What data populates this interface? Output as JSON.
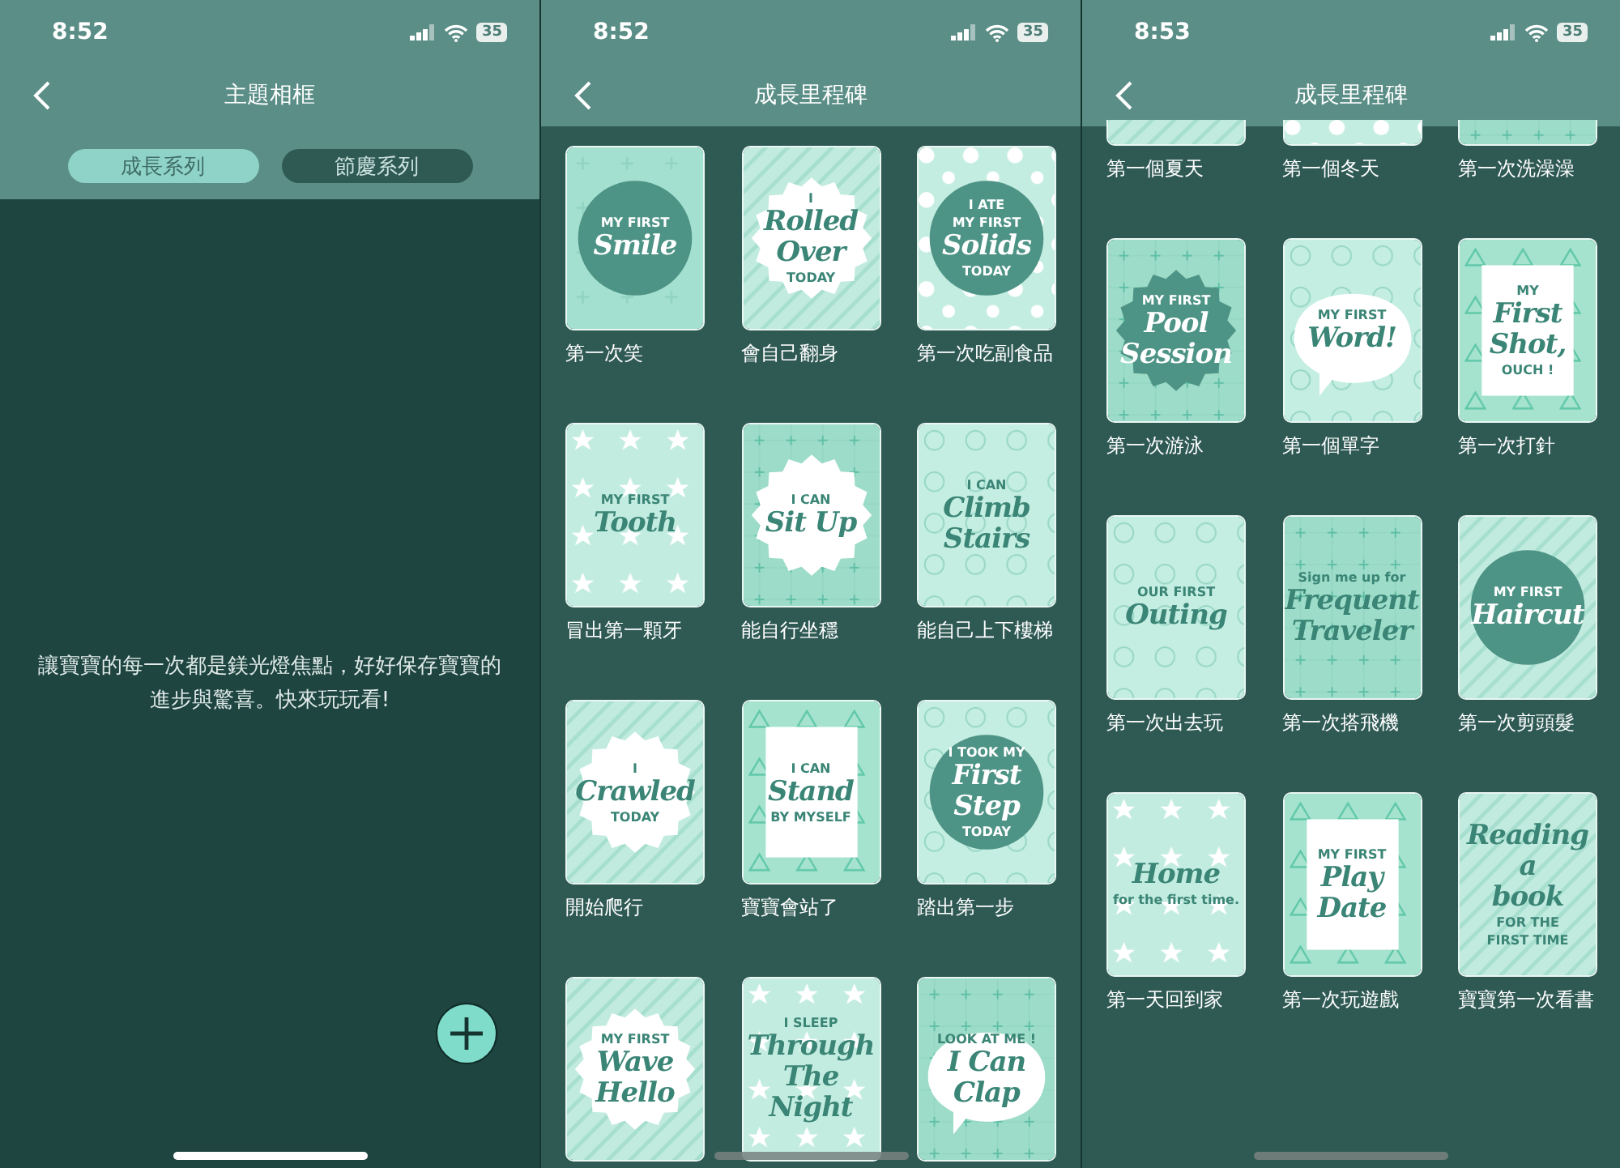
{
  "screens": [
    {
      "status": {
        "time": "8:52",
        "battery": "35"
      },
      "title": "主題相框",
      "tabs": [
        {
          "label": "成長系列",
          "selected": true
        },
        {
          "label": "節慶系列",
          "selected": false
        }
      ],
      "message": "讓寶寶的每一次都是鎂光燈焦點，好好保存寶寶的進步與驚喜。快來玩玩看!"
    },
    {
      "status": {
        "time": "8:52",
        "battery": "35"
      },
      "title": "成長里程碑",
      "milestones": [
        {
          "label": "第一次笑",
          "kind": "circle",
          "lines": [
            {
              "text": "MY FIRST",
              "kind": "small"
            },
            {
              "text": "Smile",
              "kind": "script"
            }
          ]
        },
        {
          "label": "會自己翻身",
          "kind": "burst",
          "lines": [
            {
              "text": "I",
              "kind": "small"
            },
            {
              "text": "Rolled",
              "kind": "script"
            },
            {
              "text": "Over",
              "kind": "script"
            },
            {
              "text": "TODAY",
              "kind": "small"
            }
          ]
        },
        {
          "label": "第一次吃副食品",
          "kind": "circle",
          "lines": [
            {
              "text": "I ATE",
              "kind": "small"
            },
            {
              "text": "MY FIRST",
              "kind": "small"
            },
            {
              "text": "Solids",
              "kind": "script"
            },
            {
              "text": "TODAY",
              "kind": "small"
            }
          ]
        },
        {
          "label": "冒出第一顆牙",
          "kind": "plain",
          "lines": [
            {
              "text": "MY FIRST",
              "kind": "small"
            },
            {
              "text": "Tooth",
              "kind": "script"
            }
          ]
        },
        {
          "label": "能自行坐穩",
          "kind": "burst",
          "lines": [
            {
              "text": "I CAN",
              "kind": "small"
            },
            {
              "text": "Sit Up",
              "kind": "script"
            }
          ]
        },
        {
          "label": "能自己上下樓梯",
          "kind": "plain",
          "lines": [
            {
              "text": "I CAN",
              "kind": "small"
            },
            {
              "text": "Climb",
              "kind": "script"
            },
            {
              "text": "Stairs",
              "kind": "script"
            }
          ]
        },
        {
          "label": "開始爬行",
          "kind": "burst",
          "lines": [
            {
              "text": "I",
              "kind": "small"
            },
            {
              "text": "Crawled",
              "kind": "script"
            },
            {
              "text": "TODAY",
              "kind": "small"
            }
          ]
        },
        {
          "label": "寶寶會站了",
          "kind": "rect",
          "lines": [
            {
              "text": "I CAN",
              "kind": "small"
            },
            {
              "text": "Stand",
              "kind": "script"
            },
            {
              "text": "BY MYSELF",
              "kind": "small"
            }
          ]
        },
        {
          "label": "踏出第一步",
          "kind": "circle",
          "lines": [
            {
              "text": "I TOOK MY",
              "kind": "small"
            },
            {
              "text": "First",
              "kind": "script"
            },
            {
              "text": "Step",
              "kind": "script"
            },
            {
              "text": "TODAY",
              "kind": "small"
            }
          ]
        },
        {
          "kind": "burst",
          "lines": [
            {
              "text": "MY FIRST",
              "kind": "small"
            },
            {
              "text": "Wave",
              "kind": "script"
            },
            {
              "text": "Hello",
              "kind": "script"
            }
          ]
        },
        {
          "kind": "plain",
          "lines": [
            {
              "text": "I SLEEP",
              "kind": "small"
            },
            {
              "text": "Through",
              "kind": "script"
            },
            {
              "text": "The",
              "kind": "script"
            },
            {
              "text": "Night",
              "kind": "script"
            }
          ]
        },
        {
          "kind": "bubble",
          "lines": [
            {
              "text": "LOOK AT ME !",
              "kind": "small"
            },
            {
              "text": "I Can",
              "kind": "script"
            },
            {
              "text": "Clap",
              "kind": "script"
            }
          ]
        }
      ]
    },
    {
      "status": {
        "time": "8:53",
        "battery": "35"
      },
      "title": "成長里程碑",
      "milestones": [
        {
          "label": "第一個夏天",
          "kind": "stub"
        },
        {
          "label": "第一個冬天",
          "kind": "stub"
        },
        {
          "label": "第一次洗澡澡",
          "kind": "stub"
        },
        {
          "label": "第一次游泳",
          "kind": "darkburst",
          "lines": [
            {
              "text": "MY FIRST",
              "kind": "small"
            },
            {
              "text": "Pool",
              "kind": "script"
            },
            {
              "text": "Session",
              "kind": "script"
            }
          ]
        },
        {
          "label": "第一個單字",
          "kind": "bubble",
          "lines": [
            {
              "text": "MY FIRST",
              "kind": "small"
            },
            {
              "text": "Word!",
              "kind": "script"
            }
          ]
        },
        {
          "label": "第一次打針",
          "kind": "rect",
          "lines": [
            {
              "text": "MY",
              "kind": "small"
            },
            {
              "text": "First",
              "kind": "script"
            },
            {
              "text": "Shot,",
              "kind": "script"
            },
            {
              "text": "OUCH !",
              "kind": "small"
            }
          ]
        },
        {
          "label": "第一次出去玩",
          "kind": "plain",
          "lines": [
            {
              "text": "OUR FIRST",
              "kind": "small"
            },
            {
              "text": "Outing",
              "kind": "script"
            }
          ]
        },
        {
          "label": "第一次搭飛機",
          "kind": "plain",
          "lines": [
            {
              "text": "Sign me up for",
              "kind": "small"
            },
            {
              "text": "Frequent",
              "kind": "script"
            },
            {
              "text": "Traveler",
              "kind": "script"
            }
          ]
        },
        {
          "label": "第一次剪頭髮",
          "kind": "circle",
          "lines": [
            {
              "text": "MY FIRST",
              "kind": "small"
            },
            {
              "text": "Haircut",
              "kind": "script"
            }
          ]
        },
        {
          "label": "第一天回到家",
          "kind": "plain",
          "lines": [
            {
              "text": "Home",
              "kind": "script"
            },
            {
              "text": "for the first time.",
              "kind": "small"
            }
          ]
        },
        {
          "label": "第一次玩遊戲",
          "kind": "rect",
          "lines": [
            {
              "text": "MY FIRST",
              "kind": "small"
            },
            {
              "text": "Play",
              "kind": "script"
            },
            {
              "text": "Date",
              "kind": "script"
            }
          ]
        },
        {
          "label": "寶寶第一次看書",
          "kind": "plain",
          "lines": [
            {
              "text": "Reading",
              "kind": "script"
            },
            {
              "text": "a",
              "kind": "script"
            },
            {
              "text": "book",
              "kind": "script"
            },
            {
              "text": "FOR THE",
              "kind": "small"
            },
            {
              "text": "FIRST TIME",
              "kind": "small"
            }
          ]
        }
      ]
    }
  ]
}
